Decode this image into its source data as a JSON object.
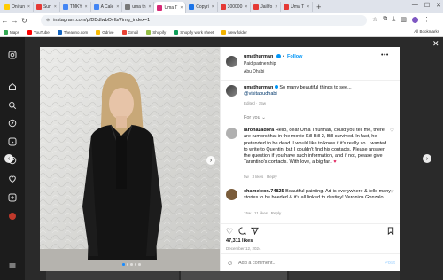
{
  "browser": {
    "tabs": [
      {
        "label": "Onirun",
        "color": "#ffcc00"
      },
      {
        "label": "Sun",
        "color": "#e53935"
      },
      {
        "label": "TMKY",
        "color": "#4285f4"
      },
      {
        "label": "A Cale",
        "color": "#4285f4"
      },
      {
        "label": "uma th",
        "color": "#777777"
      },
      {
        "label": "Uma T",
        "color": "#d62976",
        "active": true
      },
      {
        "label": "Copyri",
        "color": "#1a73e8"
      },
      {
        "label": "300000",
        "color": "#e53935"
      },
      {
        "label": "Jail fo",
        "color": "#e53935"
      },
      {
        "label": "Uma T",
        "color": "#e53935"
      }
    ],
    "new_tab": "+",
    "url": "instagram.com/p/DDdlwbOvIb/?img_index=1",
    "bookmarks": [
      {
        "label": "Maps",
        "color": "#34a853"
      },
      {
        "label": "YouTube",
        "color": "#ff0000"
      },
      {
        "label": "Theauno.com",
        "color": "#1565c0"
      },
      {
        "label": "Gdrive",
        "color": "#fbbc04"
      },
      {
        "label": "Gmail",
        "color": "#ea4335"
      },
      {
        "label": "Shopify",
        "color": "#95bf47"
      },
      {
        "label": "Shopify work sheet",
        "color": "#0f9d58"
      },
      {
        "label": "New folder",
        "color": "#f4b400"
      }
    ],
    "all_bookmarks": "All Bookmarks"
  },
  "post": {
    "username": "umathurman",
    "follow": "Follow",
    "paid_partnership": "Paid partnership",
    "location": "Abu Dhabi",
    "caption_username": "umathurman",
    "caption_text": "So many beautiful things to see...",
    "caption_mention": "@visitabudhabi",
    "caption_meta": "Edited · 15w",
    "for_you": "For you",
    "comments": [
      {
        "username": "iaronazadora",
        "text": "Hello, dear Uma Thurman, could you tell me, there are rumors that in the movie Kill Bill 2, Bill survived. In fact, he pretended to be dead. I would like to know if it's really so. I wanted to write to Quentin, but I couldn't find his contacts. Please answer the question if you have such information, and if not, please give Tarantino's contacts. With love, a big fan.",
        "emoji": "♥",
        "time": "5w",
        "likes": "3 likes",
        "reply": "Reply"
      },
      {
        "username": "chameleon.74825",
        "text": "Beautiful painting. Art is everywhere & tells many stories to be heeded & it's all linked to destiny! Veronica Gonzalo",
        "time": "15w",
        "likes": "11 likes",
        "reply": "Reply"
      }
    ],
    "likes_count": "47,311 likes",
    "date": "December 12, 2024",
    "add_comment_placeholder": "Add a comment...",
    "post_button": "Post"
  },
  "colors": {
    "accent": "#0095f6",
    "heart": "#e0245e",
    "backdrop": "#2a2a2a"
  },
  "icons": [
    "instagram-icon",
    "home-icon",
    "search-icon",
    "explore-icon",
    "reels-icon",
    "messages-icon",
    "notifications-icon",
    "create-icon",
    "profile-icon",
    "more-icon"
  ]
}
